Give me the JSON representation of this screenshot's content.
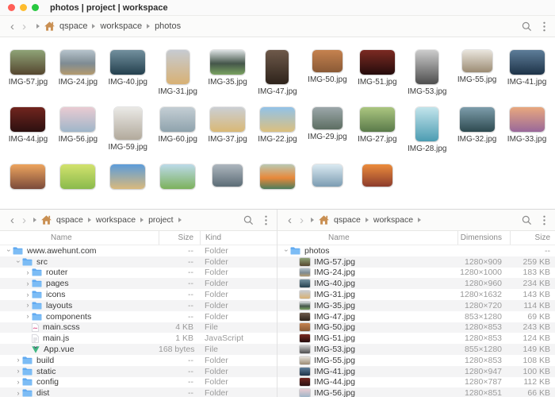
{
  "window": {
    "title": "photos | project | workspace"
  },
  "colors": {
    "accent_folder": "#61aaf1",
    "home_icon": "#c98f52",
    "vue_green": "#41b883",
    "scss_pink": "#e2689b",
    "stripe": "#f4f4f5"
  },
  "top_toolbar": {
    "breadcrumb": {
      "items": [
        "qspace",
        "workspace",
        "photos"
      ],
      "trailing": false
    }
  },
  "photo_grid": {
    "rows": [
      [
        {
          "name": "IMG-57.jpg",
          "shape": "l",
          "colors": [
            "#8fa377",
            "#55462f"
          ]
        },
        {
          "name": "IMG-24.jpg",
          "shape": "l",
          "colors": [
            "#b6c3cc",
            "#7e8b93",
            "#b49a6e"
          ]
        },
        {
          "name": "IMG-40.jpg",
          "shape": "l",
          "colors": [
            "#72909e",
            "#24404e"
          ]
        },
        {
          "name": "IMG-31.jpg",
          "shape": "p",
          "colors": [
            "#c6cbd1",
            "#d8b174"
          ]
        },
        {
          "name": "IMG-35.jpg",
          "shape": "l",
          "colors": [
            "#dde2e4",
            "#44564a",
            "#7aa260"
          ]
        },
        {
          "name": "IMG-47.jpg",
          "shape": "p",
          "colors": [
            "#6e594a",
            "#2e231b"
          ]
        },
        {
          "name": "IMG-50.jpg",
          "shape": "ls",
          "colors": [
            "#c5824f",
            "#8a5a36"
          ]
        },
        {
          "name": "IMG-51.jpg",
          "shape": "l",
          "colors": [
            "#7c2a22",
            "#250c0c"
          ]
        },
        {
          "name": "IMG-53.jpg",
          "shape": "p",
          "colors": [
            "#cccccc",
            "#4e4e4e"
          ]
        },
        {
          "name": "IMG-55.jpg",
          "shape": "ls",
          "colors": [
            "#e9e5dd",
            "#9c8c74"
          ]
        },
        {
          "name": "IMG-41.jpg",
          "shape": "l",
          "colors": [
            "#5d7d99",
            "#1e3348"
          ]
        }
      ],
      [
        {
          "name": "IMG-44.jpg",
          "shape": "l",
          "colors": [
            "#71251e",
            "#2c1010"
          ]
        },
        {
          "name": "IMG-56.jpg",
          "shape": "l",
          "colors": [
            "#e9cbd2",
            "#9fb6c9"
          ]
        },
        {
          "name": "IMG-59.jpg",
          "shape": "sq",
          "colors": [
            "#eae9e6",
            "#b2aa9c"
          ]
        },
        {
          "name": "IMG-60.jpg",
          "shape": "l",
          "colors": [
            "#c4ced4",
            "#8fa3ad"
          ]
        },
        {
          "name": "IMG-37.jpg",
          "shape": "l",
          "colors": [
            "#cbcfd4",
            "#d9b875"
          ]
        },
        {
          "name": "IMG-22.jpg",
          "shape": "l",
          "colors": [
            "#92c2e8",
            "#dcc07e"
          ]
        },
        {
          "name": "IMG-29.jpg",
          "shape": "ls",
          "colors": [
            "#9ca7aa",
            "#5d6e62"
          ]
        },
        {
          "name": "IMG-27.jpg",
          "shape": "l",
          "colors": [
            "#abc680",
            "#5a7a4a"
          ]
        },
        {
          "name": "IMG-28.jpg",
          "shape": "p",
          "colors": [
            "#c2e4eb",
            "#4c9cb2"
          ]
        },
        {
          "name": "IMG-32.jpg",
          "shape": "l",
          "colors": [
            "#7d9dab",
            "#2e4a50"
          ]
        },
        {
          "name": "IMG-33.jpg",
          "shape": "l",
          "colors": [
            "#e8a87e",
            "#99689a"
          ]
        }
      ],
      [
        {
          "name": "",
          "shape": "l",
          "colors": [
            "#eda45e",
            "#7b4b3b"
          ]
        },
        {
          "name": "",
          "shape": "l",
          "colors": [
            "#d2e26e",
            "#8aba4c"
          ]
        },
        {
          "name": "",
          "shape": "l",
          "colors": [
            "#5c9cda",
            "#d9b97c"
          ]
        },
        {
          "name": "",
          "shape": "l",
          "colors": [
            "#bcdae9",
            "#7cb15c"
          ]
        },
        {
          "name": "",
          "shape": "ls",
          "colors": [
            "#adb6be",
            "#5c6c76"
          ]
        },
        {
          "name": "",
          "shape": "l",
          "colors": [
            "#bac9b2",
            "#e8883a",
            "#4c7c5c"
          ]
        },
        {
          "name": "",
          "shape": "ls",
          "colors": [
            "#dae9f1",
            "#7c9cb2"
          ]
        },
        {
          "name": "",
          "shape": "ls",
          "colors": [
            "#ec8c3c",
            "#8c3c2c"
          ]
        }
      ]
    ]
  },
  "left_panel": {
    "breadcrumb": {
      "items": [
        "qspace",
        "workspace",
        "project"
      ],
      "trailing": true
    },
    "columns": [
      "Name",
      "Size",
      "Kind"
    ],
    "rows": [
      {
        "name": "www.awehunt.com",
        "level": 0,
        "disclosure": "open",
        "icon": "folder",
        "size": "--",
        "kind": "Folder"
      },
      {
        "name": "src",
        "level": 1,
        "disclosure": "open",
        "icon": "folder",
        "size": "--",
        "kind": "Folder"
      },
      {
        "name": "router",
        "level": 2,
        "disclosure": "closed",
        "icon": "folder",
        "size": "--",
        "kind": "Folder"
      },
      {
        "name": "pages",
        "level": 2,
        "disclosure": "closed",
        "icon": "folder",
        "size": "--",
        "kind": "Folder"
      },
      {
        "name": "icons",
        "level": 2,
        "disclosure": "closed",
        "icon": "folder",
        "size": "--",
        "kind": "Folder"
      },
      {
        "name": "layouts",
        "level": 2,
        "disclosure": "closed",
        "icon": "folder",
        "size": "--",
        "kind": "Folder"
      },
      {
        "name": "components",
        "level": 2,
        "disclosure": "closed",
        "icon": "folder",
        "size": "--",
        "kind": "Folder"
      },
      {
        "name": "main.scss",
        "level": 2,
        "disclosure": "none",
        "icon": "scss",
        "size": "4 KB",
        "kind": "File"
      },
      {
        "name": "main.js",
        "level": 2,
        "disclosure": "none",
        "icon": "js",
        "size": "1 KB",
        "kind": "JavaScript"
      },
      {
        "name": "App.vue",
        "level": 2,
        "disclosure": "none",
        "icon": "vue",
        "size": "168 bytes",
        "kind": "File"
      },
      {
        "name": "build",
        "level": 1,
        "disclosure": "closed",
        "icon": "folder",
        "size": "--",
        "kind": "Folder"
      },
      {
        "name": "static",
        "level": 1,
        "disclosure": "closed",
        "icon": "folder",
        "size": "--",
        "kind": "Folder"
      },
      {
        "name": "config",
        "level": 1,
        "disclosure": "closed",
        "icon": "folder",
        "size": "--",
        "kind": "Folder"
      },
      {
        "name": "dist",
        "level": 1,
        "disclosure": "closed",
        "icon": "folder",
        "size": "--",
        "kind": "Folder"
      }
    ]
  },
  "right_panel": {
    "breadcrumb": {
      "items": [
        "qspace",
        "workspace"
      ],
      "trailing": true
    },
    "columns": [
      "Name",
      "Dimensions",
      "Size"
    ],
    "rows": [
      {
        "name": "photos",
        "level": 0,
        "disclosure": "open",
        "icon": "folder",
        "dimensions": "",
        "size": "--"
      },
      {
        "name": "IMG-57.jpg",
        "level": 1,
        "disclosure": "none",
        "icon": "img",
        "dimensions": "1280×909",
        "size": "259 KB"
      },
      {
        "name": "IMG-24.jpg",
        "level": 1,
        "disclosure": "none",
        "icon": "img",
        "dimensions": "1280×1000",
        "size": "183 KB"
      },
      {
        "name": "IMG-40.jpg",
        "level": 1,
        "disclosure": "none",
        "icon": "img",
        "dimensions": "1280×960",
        "size": "234 KB"
      },
      {
        "name": "IMG-31.jpg",
        "level": 1,
        "disclosure": "none",
        "icon": "img",
        "dimensions": "1280×1632",
        "size": "143 KB"
      },
      {
        "name": "IMG-35.jpg",
        "level": 1,
        "disclosure": "none",
        "icon": "img",
        "dimensions": "1280×720",
        "size": "114 KB"
      },
      {
        "name": "IMG-47.jpg",
        "level": 1,
        "disclosure": "none",
        "icon": "img",
        "dimensions": "853×1280",
        "size": "69 KB"
      },
      {
        "name": "IMG-50.jpg",
        "level": 1,
        "disclosure": "none",
        "icon": "img",
        "dimensions": "1280×853",
        "size": "243 KB"
      },
      {
        "name": "IMG-51.jpg",
        "level": 1,
        "disclosure": "none",
        "icon": "img",
        "dimensions": "1280×853",
        "size": "124 KB"
      },
      {
        "name": "IMG-53.jpg",
        "level": 1,
        "disclosure": "none",
        "icon": "img",
        "dimensions": "855×1280",
        "size": "149 KB"
      },
      {
        "name": "IMG-55.jpg",
        "level": 1,
        "disclosure": "none",
        "icon": "img",
        "dimensions": "1280×853",
        "size": "108 KB"
      },
      {
        "name": "IMG-41.jpg",
        "level": 1,
        "disclosure": "none",
        "icon": "img",
        "dimensions": "1280×947",
        "size": "100 KB"
      },
      {
        "name": "IMG-44.jpg",
        "level": 1,
        "disclosure": "none",
        "icon": "img",
        "dimensions": "1280×787",
        "size": "112 KB"
      },
      {
        "name": "IMG-56.jpg",
        "level": 1,
        "disclosure": "none",
        "icon": "img",
        "dimensions": "1280×851",
        "size": "66 KB"
      }
    ]
  }
}
